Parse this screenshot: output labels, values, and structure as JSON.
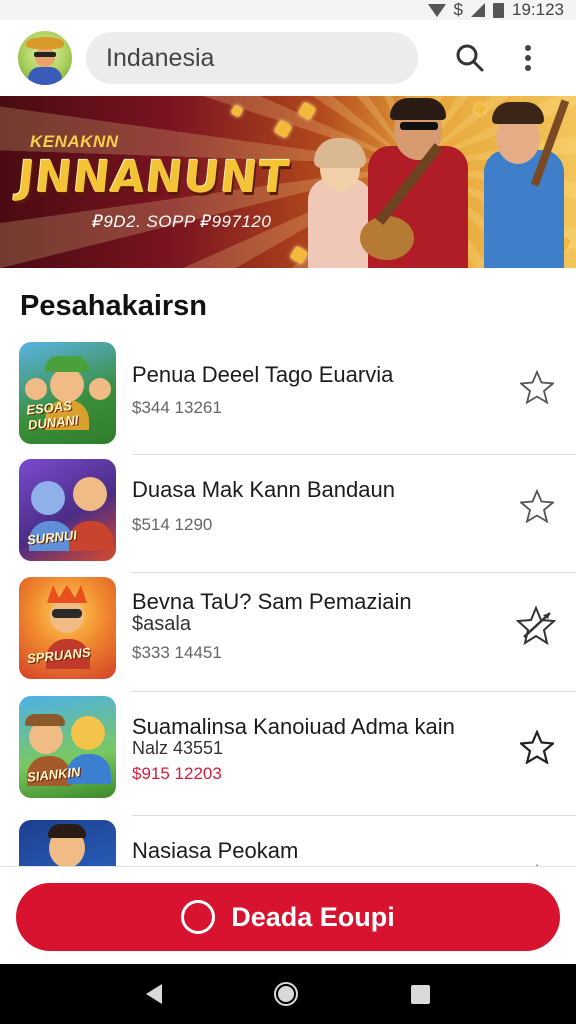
{
  "status_bar": {
    "time": "19:123",
    "dollar": "$",
    "icons": [
      "wifi-icon",
      "signal-icon",
      "battery-icon"
    ]
  },
  "header": {
    "avatar": "avatar-icon",
    "search_value": "Indanesia",
    "search_icon": "search-icon",
    "more_icon": "more-vertical-icon"
  },
  "banner": {
    "kicker": "KENAKNN",
    "title": "JNNANUNT",
    "subtitle": "₽9D2. SOPP ₽997120"
  },
  "section": {
    "title": "Pesahakairsn"
  },
  "items": [
    {
      "title": "Penua Deeel Tago Euarvia",
      "subtitle": "",
      "price": "$344 13261",
      "price_red": false,
      "thumb_label": "ESOAS DUNANI",
      "thumb_color": "#2f7d2a",
      "favorite": false
    },
    {
      "title": "Duasa Mak Kann Bandaun",
      "subtitle": "",
      "price": "$514 1290",
      "price_red": false,
      "thumb_label": "SURNUI",
      "thumb_color": "#6a3aa0",
      "favorite": false
    },
    {
      "title": "Bevna TaU? Sam Pemaziain",
      "subtitle": "$asala",
      "price": "$333 14451",
      "price_red": false,
      "thumb_label": "SPRUANS",
      "thumb_color": "#e9582e",
      "favorite": true
    },
    {
      "title": "Suamalinsa Kanoiuad Adma kain",
      "subtitle": "Nalz 43551",
      "price": "$915 12203",
      "price_red": true,
      "thumb_label": "SIANKIN",
      "thumb_color": "#3b8ed0",
      "favorite": false
    },
    {
      "title": "Nasiasa Peokam",
      "subtitle": "",
      "price": "",
      "price_red": false,
      "thumb_label": "",
      "thumb_color": "#1c3f8f",
      "favorite": false
    }
  ],
  "cta": {
    "label": "Deada Eoupi"
  },
  "colors": {
    "accent": "#d7132f",
    "price_red": "#d21d3b"
  }
}
